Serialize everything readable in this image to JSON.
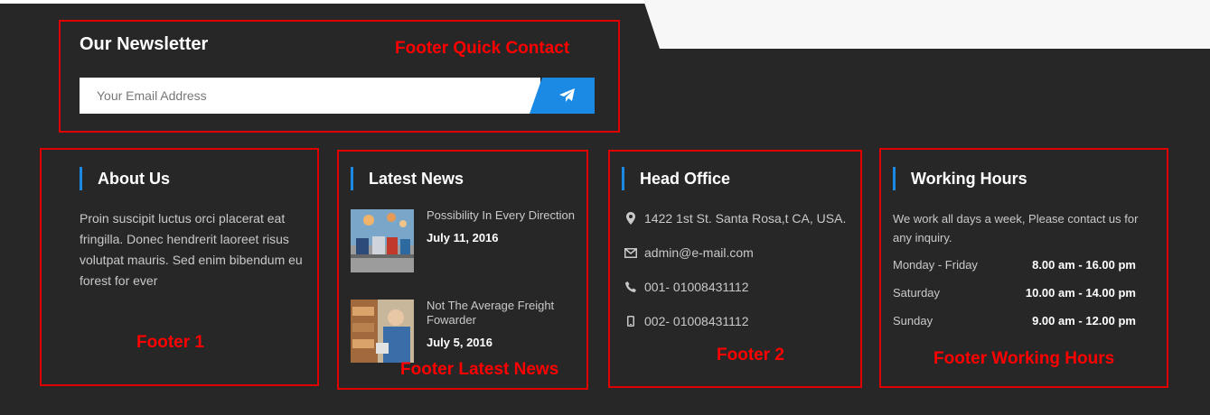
{
  "newsletter": {
    "title": "Our Newsletter",
    "placeholder": "Your Email Address",
    "submit_icon": "paper-plane-icon"
  },
  "about": {
    "heading": "About Us",
    "text": "Proin suscipit luctus orci placerat eat fringilla. Donec hendrerit laoreet risus volutpat mauris. Sed enim bibendum eu forest for ever"
  },
  "news": {
    "heading": "Latest News",
    "items": [
      {
        "title": "Possibility In Every Direction",
        "date": "July 11, 2016"
      },
      {
        "title": "Not The Average Freight Fowarder",
        "date": "July 5, 2016"
      }
    ]
  },
  "office": {
    "heading": "Head Office",
    "address": "1422 1st St. Santa Rosa,t CA, USA.",
    "email": "admin@e-mail.com",
    "phone": "001- 01008431112",
    "mobile": "002- 01008431112"
  },
  "hours": {
    "heading": "Working Hours",
    "intro": "We work all days a week, Please contact us for any inquiry.",
    "rows": [
      {
        "day": "Monday - Friday",
        "time": "8.00 am - 16.00 pm"
      },
      {
        "day": "Saturday",
        "time": "10.00 am - 14.00 pm"
      },
      {
        "day": "Sunday",
        "time": "9.00 am - 12.00 pm"
      }
    ]
  },
  "annotations": {
    "quick_contact": "Footer Quick Contact",
    "footer1": "Footer 1",
    "latest_news": "Footer Latest News",
    "footer2": "Footer 2",
    "working_hours": "Footer Working Hours"
  },
  "colors": {
    "background": "#272727",
    "accent": "#1a8ae5",
    "annotation": "#ff0000"
  }
}
